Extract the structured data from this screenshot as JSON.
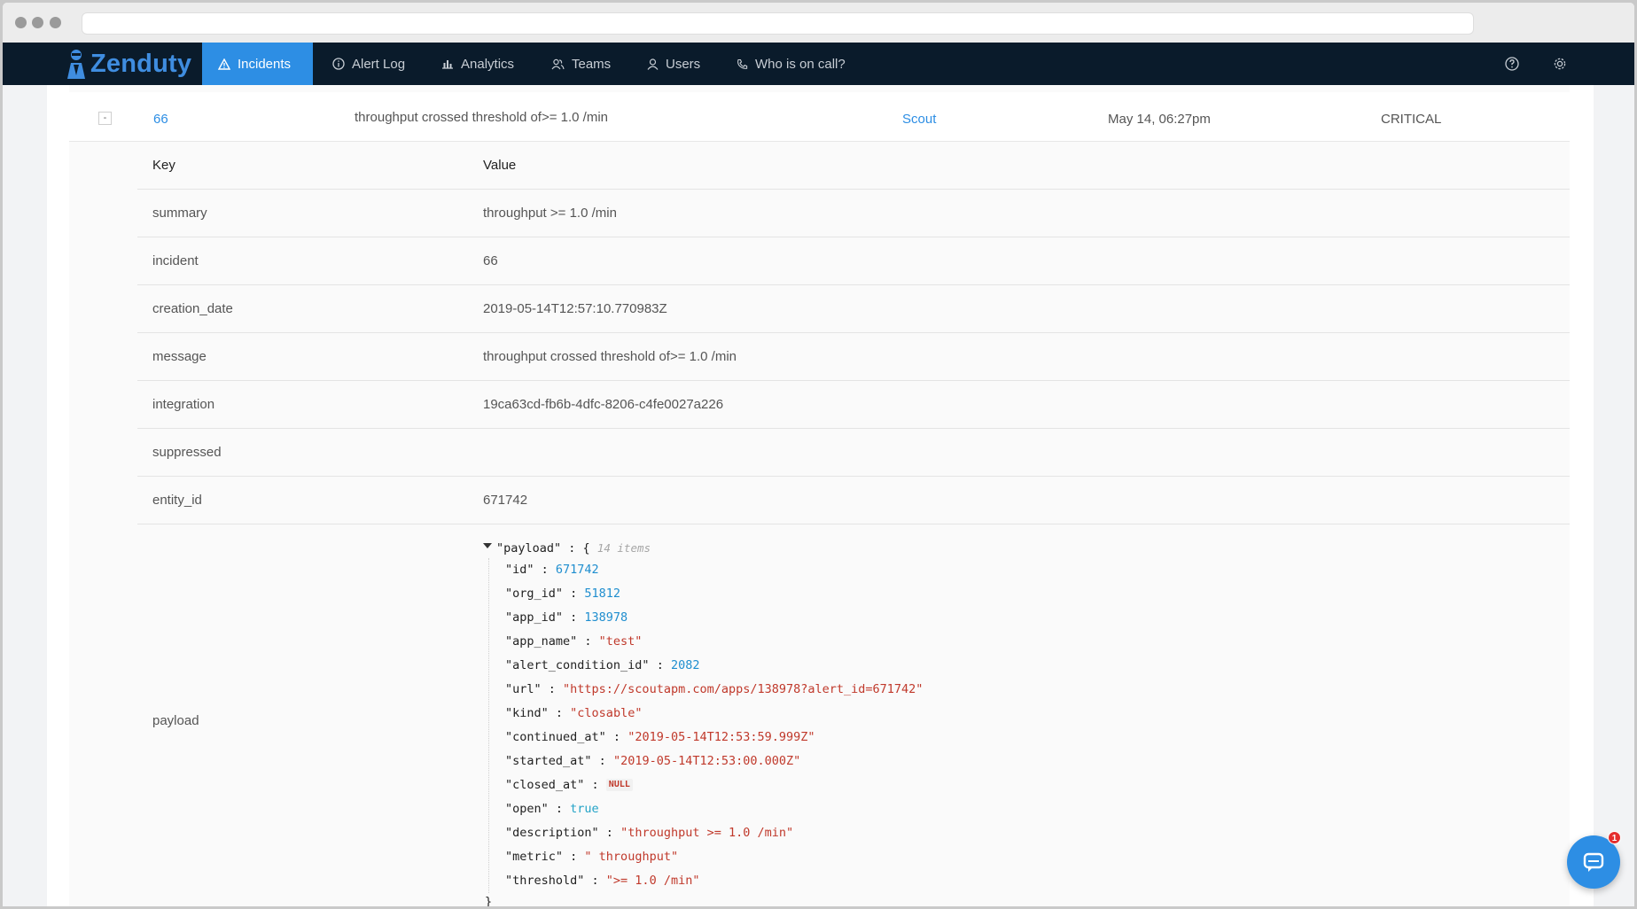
{
  "app": {
    "brand": "Zenduty",
    "brand_color": "#3f8de0",
    "accent_color": "#2d8ee4",
    "nav_bg": "#0a1b2b"
  },
  "nav": {
    "items": [
      {
        "label": "Incidents",
        "icon": "warning-triangle-icon",
        "active": true
      },
      {
        "label": "Alert Log",
        "icon": "info-circle-icon",
        "active": false
      },
      {
        "label": "Analytics",
        "icon": "bar-chart-icon",
        "active": false
      },
      {
        "label": "Teams",
        "icon": "team-icon",
        "active": false
      },
      {
        "label": "Users",
        "icon": "user-icon",
        "active": false
      },
      {
        "label": "Who is on call?",
        "icon": "phone-icon",
        "active": false
      }
    ],
    "right_icons": [
      "help-circle-icon",
      "gear-icon"
    ]
  },
  "incident": {
    "collapse_symbol": "-",
    "number": "66",
    "message": "throughput crossed threshold of>= 1.0 /min",
    "source": "Scout",
    "date": "May 14, 06:27pm",
    "urgency": "CRITICAL"
  },
  "details": {
    "header": {
      "key": "Key",
      "value": "Value"
    },
    "rows": [
      {
        "key": "summary",
        "value": "throughput >= 1.0 /min"
      },
      {
        "key": "incident",
        "value": "66"
      },
      {
        "key": "creation_date",
        "value": "2019-05-14T12:57:10.770983Z"
      },
      {
        "key": "message",
        "value": "throughput crossed threshold of>= 1.0 /min"
      },
      {
        "key": "integration",
        "value": "19ca63cd-fb6b-4dfc-8206-c4fe0027a226"
      },
      {
        "key": "suppressed",
        "value": ""
      },
      {
        "key": "entity_id",
        "value": "671742"
      }
    ],
    "payload_key": "payload"
  },
  "payload": {
    "root_key": "\"payload\"",
    "open_brace": "{",
    "close_brace": "}",
    "item_count": "14 items",
    "fields": [
      {
        "key": "\"id\"",
        "value": "671742",
        "type": "num"
      },
      {
        "key": "\"org_id\"",
        "value": "51812",
        "type": "num"
      },
      {
        "key": "\"app_id\"",
        "value": "138978",
        "type": "num"
      },
      {
        "key": "\"app_name\"",
        "value": "\"test\"",
        "type": "str"
      },
      {
        "key": "\"alert_condition_id\"",
        "value": "2082",
        "type": "num"
      },
      {
        "key": "\"url\"",
        "value": "\"https://scoutapm.com/apps/138978?alert_id=671742\"",
        "type": "str"
      },
      {
        "key": "\"kind\"",
        "value": "\"closable\"",
        "type": "str"
      },
      {
        "key": "\"continued_at\"",
        "value": "\"2019-05-14T12:53:59.999Z\"",
        "type": "str"
      },
      {
        "key": "\"started_at\"",
        "value": "\"2019-05-14T12:53:00.000Z\"",
        "type": "str"
      },
      {
        "key": "\"closed_at\"",
        "value": "NULL",
        "type": "null"
      },
      {
        "key": "\"open\"",
        "value": "true",
        "type": "bool"
      },
      {
        "key": "\"description\"",
        "value": "\"throughput >= 1.0 /min\"",
        "type": "str"
      },
      {
        "key": "\"metric\"",
        "value": "\" throughput\"",
        "type": "str"
      },
      {
        "key": "\"threshold\"",
        "value": "\">= 1.0 /min\"",
        "type": "str"
      }
    ]
  },
  "chat": {
    "badge_count": "1",
    "icon": "chat-bubble-icon"
  }
}
